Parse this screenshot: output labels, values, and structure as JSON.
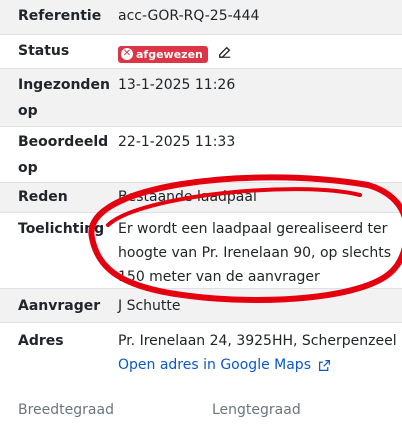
{
  "details": {
    "referentie": {
      "label": "Referentie",
      "value": "acc-GOR-RQ-25-444"
    },
    "status": {
      "label": "Status",
      "badge": "afgewezen",
      "badge_icon": "close-circle-icon",
      "badge_color": "#dc3545"
    },
    "ingezonden": {
      "label_line1": "Ingezonden",
      "label_line2": "op",
      "value": "13-1-2025 11:26"
    },
    "beoordeeld": {
      "label_line1": "Beoordeeld",
      "label_line2": "op",
      "value": "22-1-2025 11:33"
    },
    "reden": {
      "label": "Reden",
      "value": "Bestaande laadpaal"
    },
    "toelichting": {
      "label": "Toelichting",
      "lines": [
        "Er wordt een laadpaal gerealiseerd ter",
        "hoogte van Pr. Irenelaan 90, op slechts",
        "150 meter van de aanvrager"
      ]
    },
    "aanvrager": {
      "label": "Aanvrager",
      "value": "J Schutte"
    },
    "adres": {
      "label": "Adres",
      "value": "Pr. Irenelaan 24, 3925HH, Scherpenzeel",
      "link": "Open adres in Google Maps",
      "link_icon": "external-link-icon"
    }
  },
  "coordinates": {
    "breedtegraad": "Breedtegraad",
    "lengtegraad": "Lengtegraad"
  },
  "colors": {
    "row_shade": "#f2f2f2",
    "annotation_red": "#e5000f",
    "link": "#0a58ca"
  }
}
